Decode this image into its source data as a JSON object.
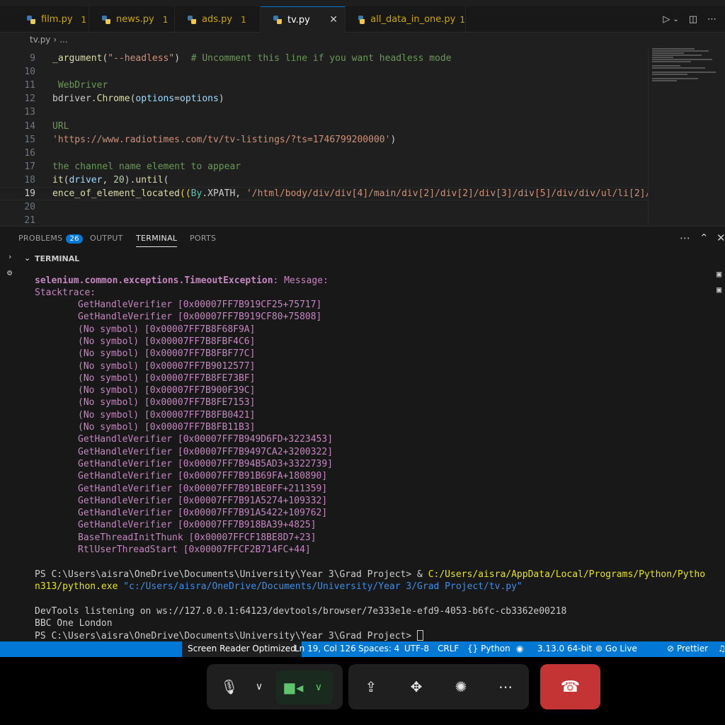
{
  "tabs": [
    {
      "label": "film.py",
      "count": "1"
    },
    {
      "label": "news.py",
      "count": "1"
    },
    {
      "label": "ads.py",
      "count": "1"
    },
    {
      "label": "tv.py",
      "active": true
    },
    {
      "label": "all_data_in_one.py",
      "count": "1"
    }
  ],
  "breadcrumb": {
    "file": "tv.py",
    "sep": "›",
    "more": "..."
  },
  "editor": {
    "lines": [
      {
        "n": "9",
        "parts": [
          {
            "t": "_argument",
            "c": "fn"
          },
          {
            "t": "(",
            "c": ""
          },
          {
            "t": "\"--headless\"",
            "c": "str"
          },
          {
            "t": ")  ",
            "c": ""
          },
          {
            "t": "# Uncomment this line if you want headless mode",
            "c": "cm"
          }
        ]
      },
      {
        "n": "10",
        "parts": []
      },
      {
        "n": "11",
        "parts": [
          {
            "t": " WebDriver",
            "c": "cm"
          }
        ]
      },
      {
        "n": "12",
        "parts": [
          {
            "t": "bdriver",
            "c": ""
          },
          {
            "t": ".",
            "c": ""
          },
          {
            "t": "Chrome",
            "c": "fn"
          },
          {
            "t": "(",
            "c": ""
          },
          {
            "t": "options",
            "c": "var"
          },
          {
            "t": "=",
            "c": ""
          },
          {
            "t": "options",
            "c": "var"
          },
          {
            "t": ")",
            "c": ""
          }
        ]
      },
      {
        "n": "13",
        "parts": []
      },
      {
        "n": "14",
        "parts": [
          {
            "t": "URL",
            "c": "cm"
          }
        ]
      },
      {
        "n": "15",
        "parts": [
          {
            "t": "'https://www.radiotimes.com/tv/tv-listings/?ts=1746799200000'",
            "c": "str"
          },
          {
            "t": ")",
            "c": ""
          }
        ]
      },
      {
        "n": "16",
        "parts": []
      },
      {
        "n": "17",
        "parts": [
          {
            "t": "the channel name element to appear",
            "c": "cm"
          }
        ]
      },
      {
        "n": "18",
        "parts": [
          {
            "t": "it",
            "c": "fn"
          },
          {
            "t": "(",
            "c": ""
          },
          {
            "t": "driver",
            "c": "var"
          },
          {
            "t": ", ",
            "c": ""
          },
          {
            "t": "20",
            "c": "num"
          },
          {
            "t": ").",
            "c": ""
          },
          {
            "t": "until",
            "c": "fn"
          },
          {
            "t": "(",
            "c": ""
          }
        ]
      },
      {
        "n": "19",
        "parts": [
          {
            "t": "ence_of_element_located",
            "c": "fn"
          },
          {
            "t": "((",
            "c": "br"
          },
          {
            "t": "By",
            "c": "cls"
          },
          {
            "t": ".XPATH, ",
            "c": ""
          },
          {
            "t": "'/html/body/div/div[4]/main/div[2]/div[2]/div[3]/div[5]/div/div/ul/li[2]/bu",
            "c": "str"
          }
        ]
      },
      {
        "n": "20",
        "parts": []
      },
      {
        "n": "21",
        "parts": []
      }
    ]
  },
  "panel": {
    "tabs": [
      "PROBLEMS",
      "OUTPUT",
      "TERMINAL",
      "PORTS"
    ],
    "problems_count": "26",
    "terminal_header": "TERMINAL"
  },
  "terminal": {
    "exception_name": "selenium.common.exceptions.TimeoutException",
    "exception_msg": ": Message:",
    "stacktrace_label": "Stacktrace:",
    "stack": [
      "GetHandleVerifier [0x00007FF7B919CF25+75717]",
      "GetHandleVerifier [0x00007FF7B919CF80+75808]",
      "(No symbol) [0x00007FF7B8F68F9A]",
      "(No symbol) [0x00007FF7B8FBF4C6]",
      "(No symbol) [0x00007FF7B8FBF77C]",
      "(No symbol) [0x00007FF7B9012577]",
      "(No symbol) [0x00007FF7B8FE73BF]",
      "(No symbol) [0x00007FF7B900F39C]",
      "(No symbol) [0x00007FF7B8FE7153]",
      "(No symbol) [0x00007FF7B8FB0421]",
      "(No symbol) [0x00007FF7B8FB11B3]",
      "GetHandleVerifier [0x00007FF7B949D6FD+3223453]",
      "GetHandleVerifier [0x00007FF7B9497CA2+3200322]",
      "GetHandleVerifier [0x00007FF7B94B5AD3+3322739]",
      "GetHandleVerifier [0x00007FF7B91B69FA+180890]",
      "GetHandleVerifier [0x00007FF7B91BE0FF+211359]",
      "GetHandleVerifier [0x00007FF7B91A5274+109332]",
      "GetHandleVerifier [0x00007FF7B91A5422+109762]",
      "GetHandleVerifier [0x00007FF7B918BA39+4825]",
      "BaseThreadInitThunk [0x00007FFCF18BE8D7+23]",
      "RtlUserThreadStart [0x00007FFCF2B714FC+44]"
    ],
    "ps_prompt": "PS C:\\Users\\aisra\\OneDrive\\Documents\\University\\Year 3\\Grad Project> & ",
    "ps_exe_1": "C:/Users/aisra/AppData/Local/Programs/Python/Pytho",
    "ps_exe_2": "n313/python.exe",
    "ps_script": " \"c:/Users/aisra/OneDrive/Documents/University/Year 3/Grad Project/tv.py\"",
    "devtools": "DevTools listening on ws://127.0.0.1:64123/devtools/browser/7e333e1e-efd9-4053-b6fc-cb3362e00218",
    "output": "BBC One London",
    "final_prompt": "PS C:\\Users\\aisra\\OneDrive\\Documents\\University\\Year 3\\Grad Project> "
  },
  "statusbar": {
    "screen_reader": "Screen Reader Optimized",
    "position": "Ln 19, Col 126",
    "spaces": "Spaces: 4",
    "encoding": "UTF-8",
    "eol": "CRLF",
    "language": "Python",
    "interpreter": "3.13.0 64-bit",
    "golive": "Go Live",
    "prettier": "Prettier"
  },
  "call": {
    "end_color": "#c43434"
  }
}
